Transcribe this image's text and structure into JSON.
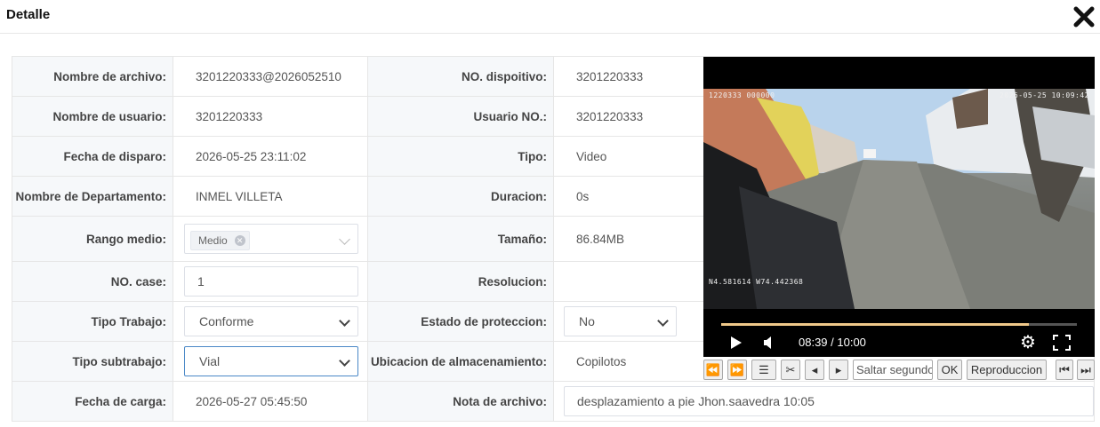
{
  "dialog": {
    "title": "Detalle",
    "close_icon": "close-icon"
  },
  "left": {
    "file_name_label": "Nombre de archivo:",
    "file_name": "3201220333@2026052510",
    "user_name_label": "Nombre de usuario:",
    "user_name": "3201220333",
    "trigger_date_label": "Fecha de disparo:",
    "trigger_date": "2026-05-25 23:11:02",
    "department_label": "Nombre de Departamento:",
    "department": "INMEL VILLETA",
    "range_label": "Rango medio:",
    "range_tag": "Medio",
    "case_label": "NO. case:",
    "case_value": "1",
    "work_type_label": "Tipo Trabajo:",
    "work_type": "Conforme",
    "subwork_label": "Tipo subtrabajo:",
    "subwork": "Vial",
    "upload_date_label": "Fecha de carga:",
    "upload_date": "2026-05-27 05:45:50"
  },
  "right": {
    "device_label": "NO. dispoitivo:",
    "device": "3201220333",
    "user_no_label": "Usuario NO.:",
    "user_no": "3201220333",
    "type_label": "Tipo:",
    "type": "Video",
    "duration_label": "Duracion:",
    "duration": "0s",
    "size_label": "Tamaño:",
    "size": "86.84MB",
    "resolution_label": "Resolucion:",
    "resolution": "",
    "protection_label": "Estado de proteccion:",
    "protection": "No",
    "storage_label": "Ubicacion de almacenamiento:",
    "storage": "Copilotos",
    "note_label": "Nota de archivo:",
    "note": "desplazamiento a pie Jhon.saavedra 10:05"
  },
  "video": {
    "osd_left": "1220333 000000",
    "osd_right": "2026-05-25 10:09:42",
    "osd_gps": "N4.581614 W74.442368",
    "time": "08:39 / 10:00",
    "progress": 0.865,
    "skip_placeholder": "Saltar segundos",
    "ok_label": "OK",
    "playback_label": "Reproduccion"
  }
}
